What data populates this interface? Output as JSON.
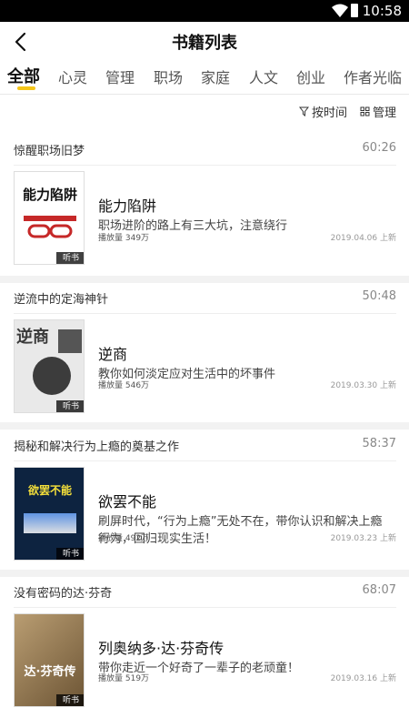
{
  "status_bar": {
    "time": "10:58"
  },
  "header": {
    "title": "书籍列表"
  },
  "tabs": [
    "全部",
    "心灵",
    "管理",
    "职场",
    "家庭",
    "人文",
    "创业",
    "作者光临"
  ],
  "toolbar": {
    "sort_label": "按时间",
    "manage_label": "管理"
  },
  "books": [
    {
      "heading": "惊醒职场旧梦",
      "duration": "60:26",
      "title": "能力陷阱",
      "desc": "职场进阶的路上有三大坑，注意绕行",
      "plays": "播放量 349万",
      "date": "2019.04.06 上新",
      "badge": "听书",
      "cover_title": "能力陷阱"
    },
    {
      "heading": "逆流中的定海神针",
      "duration": "50:48",
      "title": "逆商",
      "desc": "教你如何淡定应对生活中的坏事件",
      "plays": "播放量 546万",
      "date": "2019.03.30 上新",
      "badge": "听书",
      "cover_title": "逆商"
    },
    {
      "heading": "揭秘和解决行为上瘾的奠基之作",
      "duration": "58:37",
      "title": "欲罢不能",
      "desc": "刷屏时代，“行为上瘾”无处不在，带你认识和解决上瘾行为，回归现实生活！",
      "plays": "播放量 492万",
      "date": "2019.03.23 上新",
      "badge": "听书",
      "cover_title": "欲罢不能"
    },
    {
      "heading": "没有密码的达·芬奇",
      "duration": "68:07",
      "title": "列奥纳多·达·芬奇传",
      "desc": "带你走近一个好奇了一辈子的老顽童！",
      "plays": "播放量 519万",
      "date": "2019.03.16 上新",
      "badge": "听书",
      "cover_title": "达·芬奇传"
    }
  ],
  "colors": {
    "accent": "#f5c518",
    "status_bar": "#000000"
  }
}
